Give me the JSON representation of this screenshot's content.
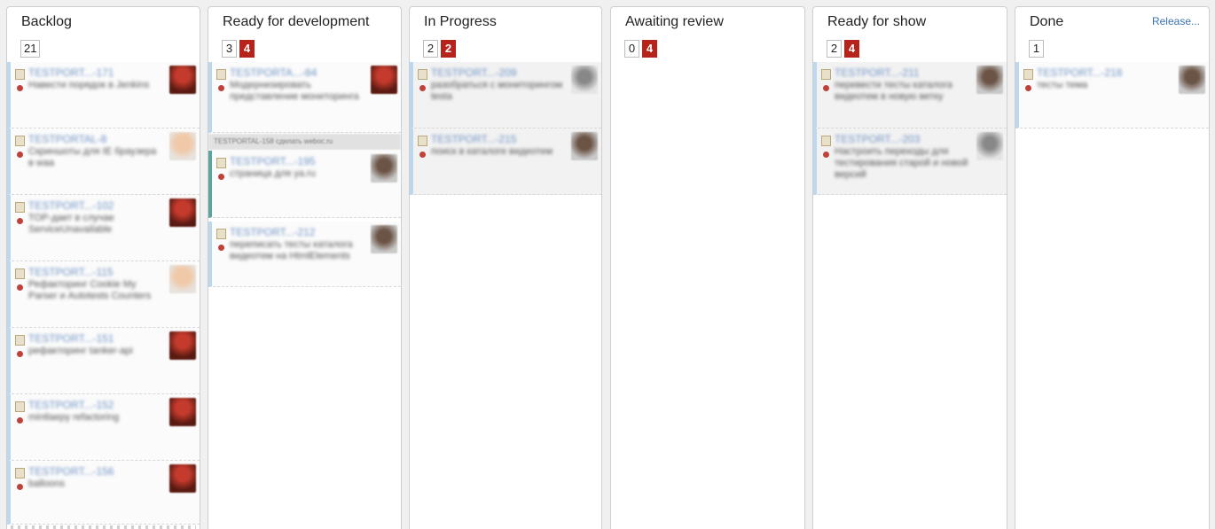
{
  "columns": [
    {
      "title": "Backlog",
      "count": "21",
      "cards": [
        {
          "key": "TESTPORT...-171",
          "summary": "Навести порядок в Jenkins",
          "avatar": "red"
        },
        {
          "key": "TESTPORTAL-8",
          "summary": "Скриншоты для IE браузера в waa",
          "avatar": "face"
        },
        {
          "key": "TESTPORT...-102",
          "summary": "TOP-дает в случае ServiceUnavailable",
          "avatar": "red"
        },
        {
          "key": "TESTPORT...-115",
          "summary": "Рефакторинг Cookie My Parser и Autotests Counters",
          "avatar": "face"
        },
        {
          "key": "TESTPORT...-151",
          "summary": "рефакторинг tanker-api",
          "avatar": "red"
        },
        {
          "key": "TESTPORT...-152",
          "summary": "mintlaepy refactoring",
          "avatar": "red"
        },
        {
          "key": "TESTPORT...-156",
          "summary": "balloons",
          "avatar": "red"
        }
      ]
    },
    {
      "title": "Ready for development",
      "count": "3",
      "limit": "4",
      "cards": [
        {
          "key": "TESTPORTA...-84",
          "summary": "Модернизировать представление мониторинга",
          "avatar": "red"
        }
      ],
      "subheader": "TESTPORTAL-158 сделать weboc.ru",
      "subcards": [
        {
          "key": "TESTPORT...-195",
          "summary": "страница для ya.ru",
          "avatar": "dark"
        },
        {
          "key": "TESTPORT...-212",
          "summary": "переписать тесты каталога видеотем на HtmlElements",
          "avatar": "dark"
        }
      ]
    },
    {
      "title": "In Progress",
      "count": "2",
      "limit": "2",
      "cards": [
        {
          "key": "TESTPORT...-209",
          "summary": "разобраться с мониторингом testa",
          "avatar": "grey"
        },
        {
          "key": "TESTPORT...-215",
          "summary": "поиск в каталоге видеотем",
          "avatar": "dark"
        }
      ]
    },
    {
      "title": "Awaiting review",
      "count": "0",
      "limit": "4",
      "cards": []
    },
    {
      "title": "Ready for show",
      "count": "2",
      "limit": "4",
      "cards": [
        {
          "key": "TESTPORT...-211",
          "summary": "перевести тесты каталога видеотем в новую ветку",
          "avatar": "dark"
        },
        {
          "key": "TESTPORT...-203",
          "summary": "Настроить переходы для тестирования старой и новой версий",
          "avatar": "grey"
        }
      ]
    },
    {
      "title": "Done",
      "count": "1",
      "release_label": "Release...",
      "cards": [
        {
          "key": "TESTPORT...-218",
          "summary": "тесты тема",
          "avatar": "dark"
        }
      ]
    }
  ]
}
